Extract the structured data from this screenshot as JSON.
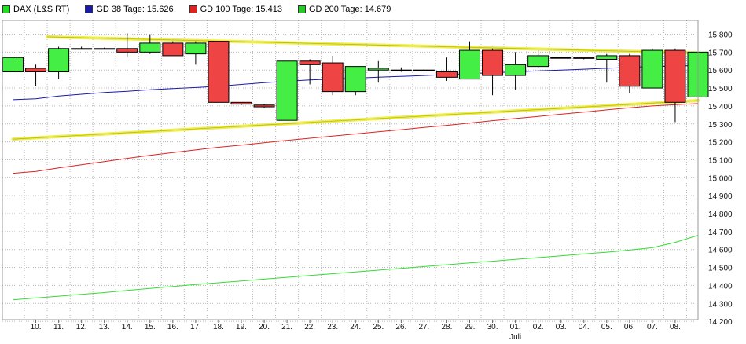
{
  "legend": {
    "items": [
      {
        "label": "DAX (L&S RT)",
        "color": "#22dd22"
      },
      {
        "label": "GD 38 Tage: 15.626",
        "color": "#1a1aaa"
      },
      {
        "label": "GD 100 Tage: 15.413",
        "color": "#dd2222"
      },
      {
        "label": "GD 200 Tage: 14.679",
        "color": "#22cc22"
      }
    ]
  },
  "colors": {
    "up": "#44ee44",
    "down": "#ee4444",
    "ma38": "#1a1aaa",
    "ma100": "#dd2222",
    "ma200": "#33dd33",
    "trendline": "#eeee33",
    "grid": "#b8b8b8",
    "plot_border": "#999999"
  },
  "chart_data": {
    "type": "candlestick",
    "ylim": [
      14150,
      15900
    ],
    "y_ticks": [
      "15.800",
      "15.700",
      "15.600",
      "15.500",
      "15.400",
      "15.300",
      "15.200",
      "15.100",
      "15.000",
      "14.900",
      "14.800",
      "14.700",
      "14.600",
      "14.500",
      "14.400",
      "14.300",
      "14.200"
    ],
    "y_tick_values": [
      15800,
      15700,
      15600,
      15500,
      15400,
      15300,
      15200,
      15100,
      15000,
      14900,
      14800,
      14700,
      14600,
      14500,
      14400,
      14300,
      14200
    ],
    "x_labels": [
      "10.",
      "11.",
      "12.",
      "13.",
      "14.",
      "15.",
      "16.",
      "17.",
      "18.",
      "19.",
      "20.",
      "21.",
      "22.",
      "23.",
      "24.",
      "25.",
      "26.",
      "27.",
      "28.",
      "29.",
      "30.",
      "01.",
      "02.",
      "03.",
      "04.",
      "05.",
      "06.",
      "07.",
      "08."
    ],
    "month_label": {
      "text": "Juli",
      "at_index": 21
    },
    "candles": [
      {
        "o": 15590,
        "h": 15680,
        "l": 15500,
        "c": 15670
      },
      {
        "o": 15610,
        "h": 15630,
        "l": 15510,
        "c": 15590
      },
      {
        "o": 15590,
        "h": 15730,
        "l": 15550,
        "c": 15720
      },
      {
        "o": 15720,
        "h": 15730,
        "l": 15715,
        "c": 15720
      },
      {
        "o": 15720,
        "h": 15725,
        "l": 15715,
        "c": 15720
      },
      {
        "o": 15720,
        "h": 15805,
        "l": 15670,
        "c": 15700
      },
      {
        "o": 15700,
        "h": 15800,
        "l": 15690,
        "c": 15750
      },
      {
        "o": 15750,
        "h": 15760,
        "l": 15680,
        "c": 15680
      },
      {
        "o": 15690,
        "h": 15760,
        "l": 15630,
        "c": 15750
      },
      {
        "o": 15760,
        "h": 15760,
        "l": 15420,
        "c": 15420
      },
      {
        "o": 15420,
        "h": 15420,
        "l": 15405,
        "c": 15410
      },
      {
        "o": 15405,
        "h": 15410,
        "l": 15390,
        "c": 15395
      },
      {
        "o": 15320,
        "h": 15650,
        "l": 15320,
        "c": 15650
      },
      {
        "o": 15650,
        "h": 15660,
        "l": 15520,
        "c": 15630
      },
      {
        "o": 15640,
        "h": 15680,
        "l": 15460,
        "c": 15480
      },
      {
        "o": 15480,
        "h": 15620,
        "l": 15460,
        "c": 15620
      },
      {
        "o": 15600,
        "h": 15650,
        "l": 15530,
        "c": 15610
      },
      {
        "o": 15600,
        "h": 15615,
        "l": 15590,
        "c": 15600
      },
      {
        "o": 15600,
        "h": 15605,
        "l": 15595,
        "c": 15600
      },
      {
        "o": 15590,
        "h": 15670,
        "l": 15540,
        "c": 15560
      },
      {
        "o": 15550,
        "h": 15760,
        "l": 15550,
        "c": 15710
      },
      {
        "o": 15710,
        "h": 15720,
        "l": 15460,
        "c": 15570
      },
      {
        "o": 15570,
        "h": 15700,
        "l": 15490,
        "c": 15630
      },
      {
        "o": 15620,
        "h": 15710,
        "l": 15610,
        "c": 15680
      },
      {
        "o": 15670,
        "h": 15670,
        "l": 15665,
        "c": 15668
      },
      {
        "o": 15670,
        "h": 15675,
        "l": 15660,
        "c": 15665
      },
      {
        "o": 15660,
        "h": 15690,
        "l": 15530,
        "c": 15680
      },
      {
        "o": 15680,
        "h": 15690,
        "l": 15470,
        "c": 15510
      },
      {
        "o": 15500,
        "h": 15720,
        "l": 15500,
        "c": 15710
      },
      {
        "o": 15710,
        "h": 15720,
        "l": 15310,
        "c": 15420
      },
      {
        "o": 15450,
        "h": 15700,
        "l": 15440,
        "c": 15700
      }
    ],
    "series": [
      {
        "name": "GD 38 Tage",
        "values": [
          15435,
          15440,
          15455,
          15465,
          15475,
          15482,
          15490,
          15497,
          15503,
          15510,
          15520,
          15530,
          15538,
          15545,
          15550,
          15555,
          15560,
          15565,
          15570,
          15575,
          15580,
          15585,
          15590,
          15595,
          15600,
          15605,
          15610,
          15615,
          15620,
          15622,
          15626
        ]
      },
      {
        "name": "GD 100 Tage",
        "values": [
          15025,
          15035,
          15055,
          15072,
          15090,
          15108,
          15125,
          15140,
          15155,
          15170,
          15182,
          15195,
          15208,
          15220,
          15232,
          15244,
          15256,
          15268,
          15280,
          15292,
          15305,
          15318,
          15330,
          15342,
          15354,
          15366,
          15378,
          15390,
          15400,
          15407,
          15413
        ]
      },
      {
        "name": "GD 200 Tage",
        "values": [
          14320,
          14330,
          14340,
          14350,
          14360,
          14372,
          14383,
          14394,
          14405,
          14415,
          14425,
          14435,
          14445,
          14455,
          14465,
          14475,
          14485,
          14495,
          14505,
          14515,
          14525,
          14535,
          14545,
          14555,
          14565,
          14575,
          14585,
          14597,
          14610,
          14640,
          14679
        ]
      }
    ],
    "trendlines": [
      {
        "x1": 1.5,
        "y1": 15785,
        "x2": 30.0,
        "y2": 15695
      },
      {
        "x1": 0.0,
        "y1": 15215,
        "x2": 30.0,
        "y2": 15430
      }
    ]
  }
}
